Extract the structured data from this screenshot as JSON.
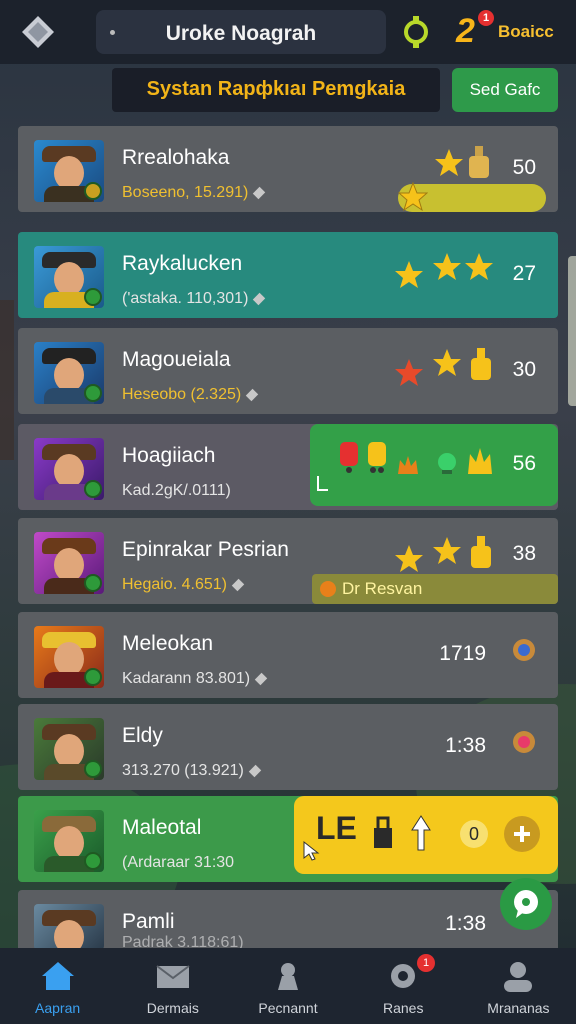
{
  "topbar": {
    "title": "Uroke Noagrah",
    "brand_number": "2",
    "brand_badge": "1",
    "brand_text": "Boaicc"
  },
  "header": {
    "headline": "Systan Rapфkıaı Pemgkaia",
    "send_button": "Sed Gafc"
  },
  "players": [
    {
      "name": "Rrealohaka",
      "sub": "Boseeno, 15.291)",
      "score": "50"
    },
    {
      "name": "Raykalucken",
      "sub": "('astaka. 110,301)",
      "score": "27"
    },
    {
      "name": "Magoueiala",
      "sub": "Heseobo (2.325)",
      "score": "30"
    },
    {
      "name": "Hoagiiach",
      "sub": "Kad.2gK/.0111)",
      "score": "56"
    },
    {
      "name": "Epinrakar Pesrian",
      "sub": "Hegaio. 4.651)",
      "score": "38"
    },
    {
      "name": "Meleokan",
      "sub": "Kadarann 83.801)",
      "time": "1719"
    },
    {
      "name": "Eldy",
      "sub": "313.270 (13.921)",
      "time": "1:38"
    },
    {
      "name": "Maleotal",
      "sub": "(Ardaraar 31:30",
      "card_value": "0"
    },
    {
      "name": "Pamli",
      "sub": "Padrak 3.118:61)",
      "time": "1:38"
    }
  ],
  "dr_bar": "Dr Resvan",
  "yellow_card_text": "LE",
  "nav": [
    {
      "label": "Aapran",
      "icon": "home-icon"
    },
    {
      "label": "Dermais",
      "icon": "mail-icon"
    },
    {
      "label": "Pecnannt",
      "icon": "profile-bust-icon"
    },
    {
      "label": "Ranes",
      "icon": "gear-icon",
      "badge": "1"
    },
    {
      "label": "Mrananas",
      "icon": "user-icon"
    }
  ],
  "colors": {
    "accent": "#3aa0f0",
    "gold": "#f2b418",
    "green": "#2e9a4a",
    "teal": "#278a7e"
  }
}
